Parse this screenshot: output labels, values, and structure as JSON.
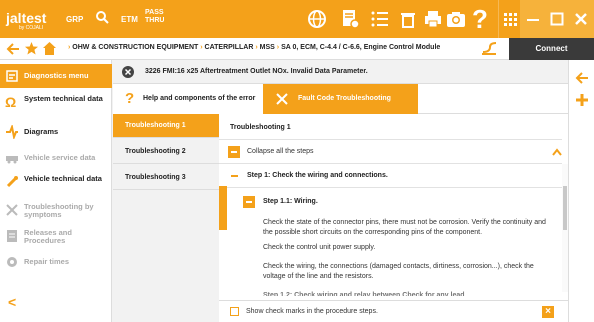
{
  "top": {
    "logo": "jaltest",
    "logo_sub": "by COJALI",
    "grp": "GRP",
    "etm": "ETM",
    "pass_line1": "PASS",
    "pass_line2": "THRU",
    "help": "?"
  },
  "nav": {
    "breadcrumb_parts": [
      "OHW & CONSTRUCTION EQUIPMENT",
      "CATERPILLAR",
      "MSS",
      "SA 0, ECM, C-4.4 / C-6.6, Engine Control Module"
    ],
    "connect_label": "Connect"
  },
  "sidebar": {
    "items": [
      {
        "label": "Diagnostics menu",
        "state": "active",
        "icon": "stethoscope-icon"
      },
      {
        "label": "System technical data",
        "state": "normal",
        "icon": "omega-icon"
      },
      {
        "label": "Diagrams",
        "state": "normal",
        "icon": "diagram-icon"
      },
      {
        "label": "Vehicle service data",
        "state": "disabled",
        "icon": "vehicle-icon"
      },
      {
        "label": "Vehicle technical data",
        "state": "normal",
        "icon": "wrench-icon"
      },
      {
        "label": "Troubleshooting by symptoms",
        "state": "disabled",
        "icon": "tools-icon"
      },
      {
        "label": "Releases and Procedures",
        "state": "disabled",
        "icon": "document-icon"
      },
      {
        "label": "Repair times",
        "state": "disabled",
        "icon": "gear-icon"
      }
    ],
    "collapse_glyph": "<"
  },
  "error": {
    "text": "3226 FMI:16  x25  Aftertreatment Outlet NOx. Invalid Data Parameter."
  },
  "tabs": {
    "help_tab": "Help and components of the error",
    "fault_tab": "Fault Code Troubleshooting"
  },
  "troubleshooting": {
    "items": [
      "Troubleshooting 1",
      "Troubleshooting 2",
      "Troubleshooting 3"
    ],
    "title": "Troubleshooting 1",
    "collapse_all": "Collapse all the steps",
    "step1": "Step 1: Check the wiring and connections.",
    "step11": "Step 1.1: Wiring.",
    "p1": "Check the state of the connector pins, there must not be corrosion. Verify the continuity and the possible short circuits on the corresponding pins of the component.",
    "p2": "Check the control unit power supply.",
    "p3": "Check the wiring, the connections (damaged contacts, dirtiness, corrosion...), check the voltage of the line and the resistors.",
    "step12_partial": "Step 1.2: Check wiring and relay between  Check for any lead",
    "show_checks": "Show check marks in the procedure steps."
  }
}
